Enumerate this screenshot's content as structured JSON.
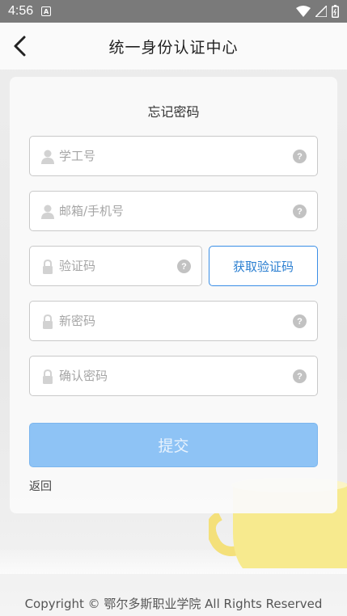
{
  "status_bar": {
    "time": "4:56",
    "app_glyph": "A"
  },
  "header": {
    "title": "统一身份认证中心"
  },
  "card": {
    "title": "忘记密码",
    "fields": {
      "student_id": {
        "placeholder": "学工号",
        "help": "?"
      },
      "email_phone": {
        "placeholder": "邮箱/手机号",
        "help": "?"
      },
      "captcha": {
        "placeholder": "验证码",
        "help": "?"
      },
      "new_password": {
        "placeholder": "新密码",
        "help": "?"
      },
      "confirm_password": {
        "placeholder": "确认密码",
        "help": "?"
      }
    },
    "captcha_button": "获取验证码",
    "submit_button": "提交",
    "return_link": "返回"
  },
  "footer": {
    "copyright": "Copyright © 鄂尔多斯职业学院 All Rights Reserved"
  },
  "colors": {
    "accent": "#3a8ee6",
    "submit_disabled": "#8ec3f5",
    "status_bar": "#7a7a7a"
  },
  "icons": [
    "back-arrow-icon",
    "user-icon",
    "lock-icon",
    "help-icon",
    "wifi-icon",
    "signal-icon",
    "battery-icon"
  ]
}
